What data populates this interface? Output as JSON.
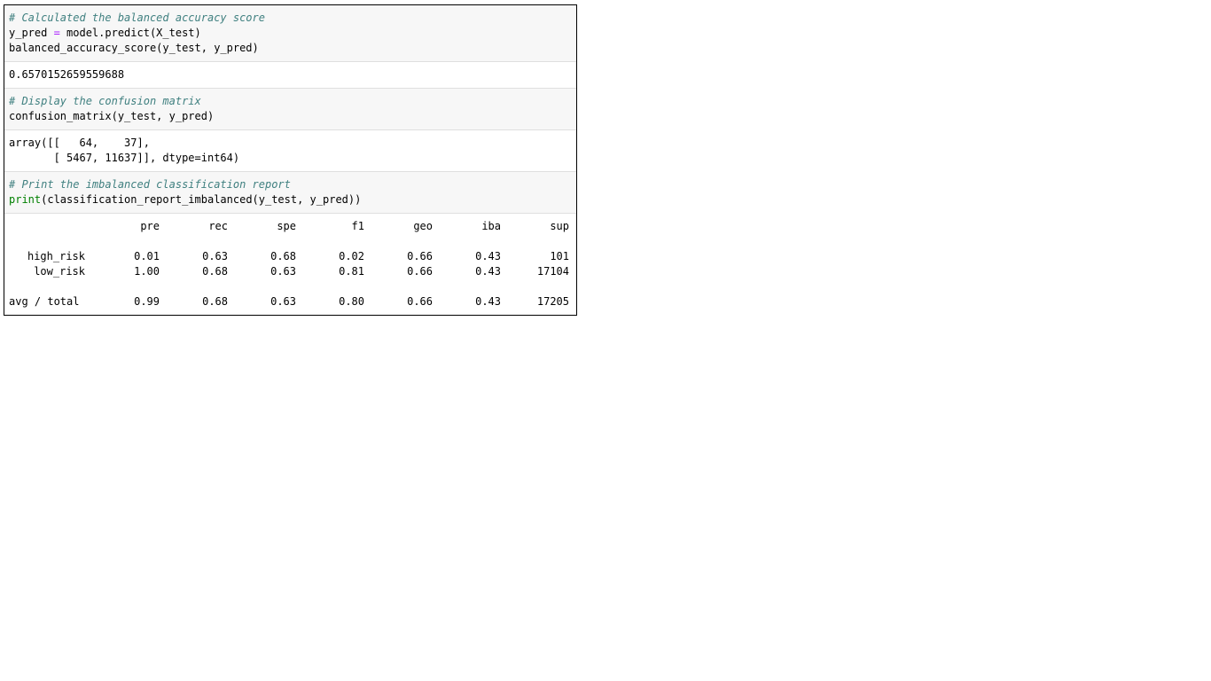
{
  "cells": {
    "balanced_accuracy": {
      "input": {
        "comment": "# Calculated the balanced accuracy score",
        "line2_left": "y_pred ",
        "line2_op": "=",
        "line2_right": " model.predict(X_test)",
        "line3": "balanced_accuracy_score(y_test, y_pred)"
      },
      "output": "0.6570152659559688"
    },
    "confusion": {
      "input": {
        "comment": "# Display the confusion matrix",
        "line2": "confusion_matrix(y_test, y_pred)"
      },
      "output": {
        "line1": "array([[   64,    37],",
        "line2": "       [ 5467, 11637]], dtype=int64)"
      }
    },
    "report": {
      "input": {
        "comment": "# Print the imbalanced classification report",
        "builtin": "print",
        "rest": "(classification_report_imbalanced(y_test, y_pred))"
      },
      "output": {
        "headers": [
          "pre",
          "rec",
          "spe",
          "f1",
          "geo",
          "iba",
          "sup"
        ],
        "rows": [
          {
            "label": "high_risk",
            "values": [
              "0.01",
              "0.63",
              "0.68",
              "0.02",
              "0.66",
              "0.43",
              "101"
            ]
          },
          {
            "label": "low_risk",
            "values": [
              "1.00",
              "0.68",
              "0.63",
              "0.81",
              "0.66",
              "0.43",
              "17104"
            ]
          }
        ],
        "total": {
          "label": "avg / total",
          "values": [
            "0.99",
            "0.68",
            "0.63",
            "0.80",
            "0.66",
            "0.43",
            "17205"
          ]
        }
      }
    }
  },
  "colors": {
    "comment": "#408080",
    "operator": "#aa22ff",
    "builtin": "#008000",
    "input_bg": "#f7f7f7",
    "border": "#000000"
  }
}
